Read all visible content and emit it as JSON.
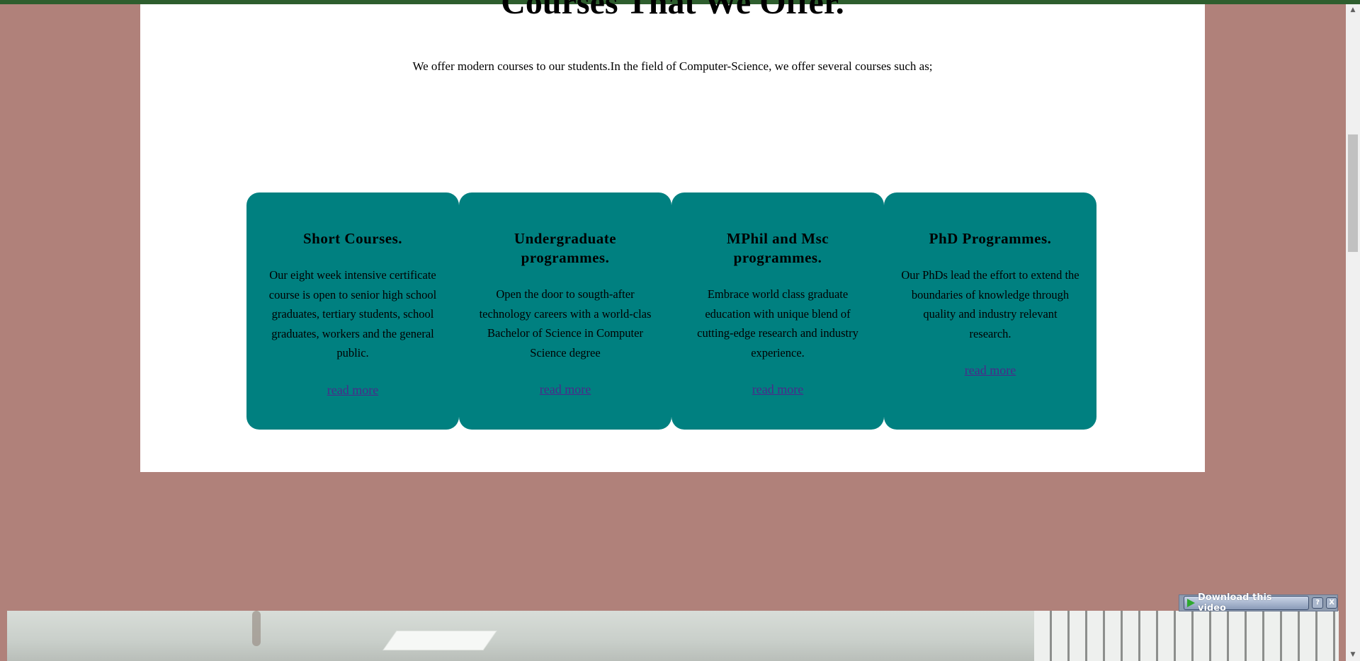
{
  "page": {
    "heading": "Courses That We Offer.",
    "intro": "We offer modern courses to our students.In the field of Computer-Science, we offer several courses such as;"
  },
  "cards": [
    {
      "title": "Short Courses.",
      "text": "Our eight week intensive certificate course is open to senior high school graduates, tertiary students, school graduates, workers and the general public.",
      "link": "read more"
    },
    {
      "title": "Undergraduate programmes.",
      "text": "Open the door to sougth-after technology careers with a world-clas Bachelor of Science in Computer Science degree",
      "link": "read more"
    },
    {
      "title": "MPhil and Msc programmes.",
      "text": "Embrace world class graduate education with unique blend of cutting-edge research and industry experience.",
      "link": "read more"
    },
    {
      "title": "PhD Programmes.",
      "text": "Our PhDs lead the effort to extend the boundaries of knowledge through quality and industry relevant research.",
      "link": "read more"
    }
  ],
  "download_bar": {
    "label": "Download this video",
    "help": "?",
    "close": "X"
  },
  "colors": {
    "background": "#b0817a",
    "card": "#008080",
    "link": "#4b2a8a"
  }
}
